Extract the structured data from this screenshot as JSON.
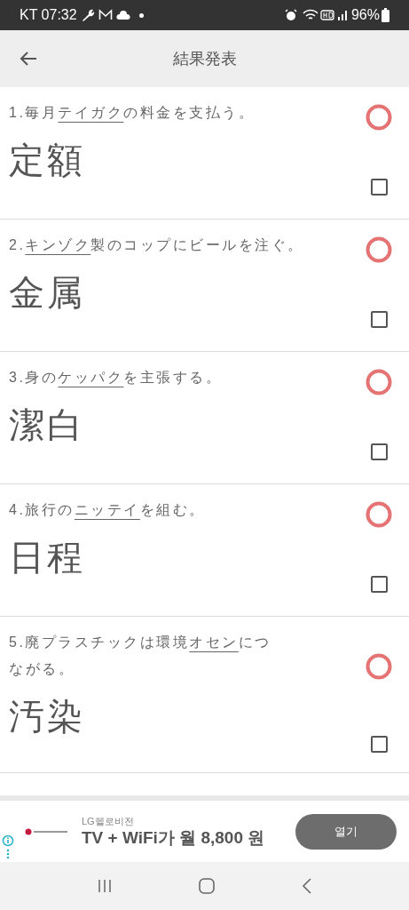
{
  "status_bar": {
    "carrier_time": "KT 07:32",
    "battery": "96%"
  },
  "header": {
    "title": "結果発表"
  },
  "questions": [
    {
      "number": "1.",
      "before": "毎月",
      "underlined": "テイガク",
      "after": "の料金を支払う。",
      "answer": "定額",
      "correct": true,
      "checked": false
    },
    {
      "number": "2.",
      "underlined": "キンゾク",
      "after": "製のコップにビールを注ぐ。",
      "answer": "金属",
      "correct": true,
      "checked": false
    },
    {
      "number": "3.",
      "before": "身の",
      "underlined": "ケッパク",
      "after": "を主張する。",
      "answer": "潔白",
      "correct": true,
      "checked": false
    },
    {
      "number": "4.",
      "before": "旅行の",
      "underlined": "ニッテイ",
      "after": "を組む。",
      "answer": "日程",
      "correct": true,
      "checked": false
    },
    {
      "number": "5.",
      "before": "廃プラスチックは環境",
      "underlined": "オセン",
      "after": "につながる。",
      "answer": "汚染",
      "correct": true,
      "checked": false
    }
  ],
  "ad": {
    "advertiser": "LG헬로비전",
    "headline": "TV + WiFi가 월 8,800 원",
    "button": "열기"
  }
}
